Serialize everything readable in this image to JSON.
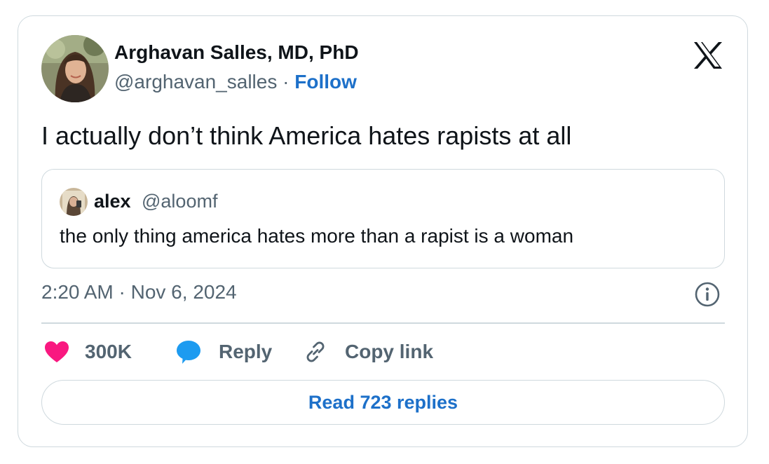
{
  "author": {
    "name": "Arghavan Salles, MD, PhD",
    "handle": "@arghavan_salles",
    "separator": " · ",
    "follow_label": "Follow"
  },
  "tweet": {
    "text": "I actually don’t think America hates rapists at all"
  },
  "quoted_tweet": {
    "name": "alex",
    "handle": "@aloomf",
    "text": "the only thing america hates more than a rapist is a woman"
  },
  "timestamp": "2:20 AM · Nov 6, 2024",
  "actions": {
    "like_count": "300K",
    "reply_label": "Reply",
    "copy_link_label": "Copy link"
  },
  "read_replies_label": "Read 723 replies",
  "icons": {
    "logo": "x-logo-icon",
    "info": "info-icon",
    "like": "heart-icon",
    "reply": "speech-bubble-icon",
    "copy": "link-icon"
  },
  "colors": {
    "text_primary": "#0f1419",
    "text_secondary": "#536471",
    "link_blue": "#1d70c9",
    "heart_pink": "#f91880",
    "reply_blue": "#1d9bf0",
    "border": "#cfd9de"
  }
}
